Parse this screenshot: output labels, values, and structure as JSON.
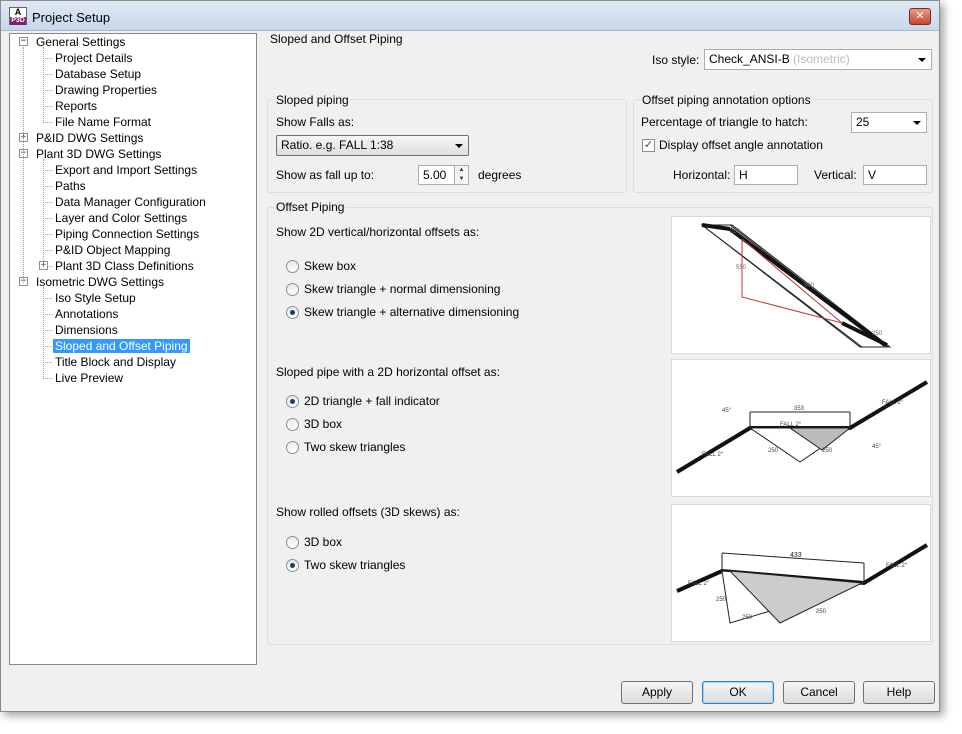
{
  "window": {
    "title": "Project Setup",
    "icon_label": "A",
    "icon_sub": "P3D",
    "close_icon": "close-x-icon"
  },
  "tree": [
    {
      "label": "General Settings",
      "level": 0,
      "expander": "minus"
    },
    {
      "label": "Project Details",
      "level": 1
    },
    {
      "label": "Database Setup",
      "level": 1
    },
    {
      "label": "Drawing Properties",
      "level": 1
    },
    {
      "label": "Reports",
      "level": 1
    },
    {
      "label": "File Name Format",
      "level": 1
    },
    {
      "label": "P&ID DWG Settings",
      "level": 0,
      "expander": "plus"
    },
    {
      "label": "Plant 3D DWG Settings",
      "level": 0,
      "expander": "minus"
    },
    {
      "label": "Export and Import Settings",
      "level": 1
    },
    {
      "label": "Paths",
      "level": 1
    },
    {
      "label": "Data Manager Configuration",
      "level": 1
    },
    {
      "label": "Layer and Color Settings",
      "level": 1
    },
    {
      "label": "Piping Connection Settings",
      "level": 1
    },
    {
      "label": "P&ID Object Mapping",
      "level": 1
    },
    {
      "label": "Plant 3D Class Definitions",
      "level": 1,
      "expander": "plus"
    },
    {
      "label": "Isometric DWG Settings",
      "level": 0,
      "expander": "minus"
    },
    {
      "label": "Iso Style Setup",
      "level": 1
    },
    {
      "label": "Annotations",
      "level": 1
    },
    {
      "label": "Dimensions",
      "level": 1
    },
    {
      "label": "Sloped and Offset Piping",
      "level": 1,
      "selected": true
    },
    {
      "label": "Title Block and Display",
      "level": 1
    },
    {
      "label": "Live Preview",
      "level": 1
    }
  ],
  "panel": {
    "title": "Sloped and Offset Piping",
    "iso_style": {
      "label": "Iso style:",
      "value": "Check_ANSI-B",
      "hint": "(Isometric)"
    },
    "sloped": {
      "group_title": "Sloped piping",
      "show_falls_label": "Show Falls as:",
      "show_falls_value": "Ratio. e.g. FALL 1:38",
      "fall_up_label": "Show as fall up to:",
      "fall_up_value": "5.00",
      "fall_up_unit": "degrees"
    },
    "annotation": {
      "group_title": "Offset piping annotation options",
      "hatch_label": "Percentage of triangle to hatch:",
      "hatch_value": "25",
      "display_angle_label": "Display offset angle annotation",
      "display_angle_checked": true,
      "horizontal_label": "Horizontal:",
      "horizontal_value": "H",
      "vertical_label": "Vertical:",
      "vertical_value": "V"
    },
    "offset": {
      "group_title": "Offset Piping",
      "section1": {
        "label": "Show 2D vertical/horizontal offsets as:",
        "options": [
          "Skew box",
          "Skew triangle + normal dimensioning",
          "Skew triangle + alternative dimensioning"
        ],
        "selected": 2
      },
      "section2": {
        "label": "Sloped pipe with a 2D horizontal offset as:",
        "options": [
          "2D triangle + fall indicator",
          "3D box",
          "Two skew triangles"
        ],
        "selected": 0
      },
      "section3": {
        "label": "Show rolled offsets (3D skews) as:",
        "options": [
          "3D box",
          "Two skew triangles"
        ],
        "selected": 1
      },
      "preview1": {
        "labels": [
          "250",
          "550",
          "500",
          "250"
        ]
      },
      "preview2": {
        "labels": [
          "45°",
          "353",
          "FALL 2°",
          "FALL 2°",
          "FALL 2°",
          "250",
          "250",
          "45°"
        ]
      },
      "preview3": {
        "labels": [
          "433",
          "FALL 2°",
          "FALL 2°",
          "250",
          "250",
          "250"
        ]
      }
    }
  },
  "buttons": {
    "apply": "Apply",
    "ok": "OK",
    "cancel": "Cancel",
    "help": "Help"
  }
}
